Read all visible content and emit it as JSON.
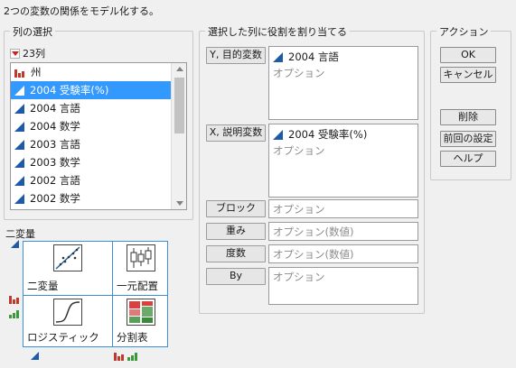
{
  "header": {
    "description": "2つの変数の関係をモデル化する。"
  },
  "column_select": {
    "title": "列の選択",
    "count_label": "23列",
    "items": [
      {
        "label": "州",
        "icon": "nominal-bars-icon"
      },
      {
        "label": "2004 受験率(%)",
        "icon": "continuous-triangle-icon",
        "selected": true
      },
      {
        "label": "2004 言語",
        "icon": "continuous-triangle-icon"
      },
      {
        "label": "2004 数学",
        "icon": "continuous-triangle-icon"
      },
      {
        "label": "2003 言語",
        "icon": "continuous-triangle-icon"
      },
      {
        "label": "2003 数学",
        "icon": "continuous-triangle-icon"
      },
      {
        "label": "2002 言語",
        "icon": "continuous-triangle-icon"
      },
      {
        "label": "2002 数学",
        "icon": "continuous-triangle-icon"
      }
    ]
  },
  "roles": {
    "title": "選択した列に役割を割り当てる",
    "y": {
      "button": "Y, 目的変数",
      "value": "2004 言語",
      "placeholder": "オプション"
    },
    "x": {
      "button": "X, 説明変数",
      "value": "2004 受験率(%)",
      "placeholder": "オプション"
    },
    "block": {
      "button": "ブロック",
      "placeholder": "オプション"
    },
    "weight": {
      "button": "重み",
      "placeholder": "オプション(数値)"
    },
    "freq": {
      "button": "度数",
      "placeholder": "オプション(数値)"
    },
    "by": {
      "button": "By",
      "placeholder": "オプション"
    }
  },
  "actions": {
    "title": "アクション",
    "ok": "OK",
    "cancel": "キャンセル",
    "remove": "削除",
    "recall": "前回の設定",
    "help": "ヘルプ"
  },
  "bivariate": {
    "title": "二変量",
    "tiles": {
      "bivariate": "二変量",
      "oneway": "一元配置",
      "logistic": "ロジスティック",
      "contingency": "分割表"
    }
  },
  "colors": {
    "selection": "#3399ff",
    "continuous_icon": "#1e5aa8",
    "nominal_icon": "#c0392b",
    "ordinal_icon": "#3a9a3a",
    "tile_border": "#3a8fd6"
  }
}
